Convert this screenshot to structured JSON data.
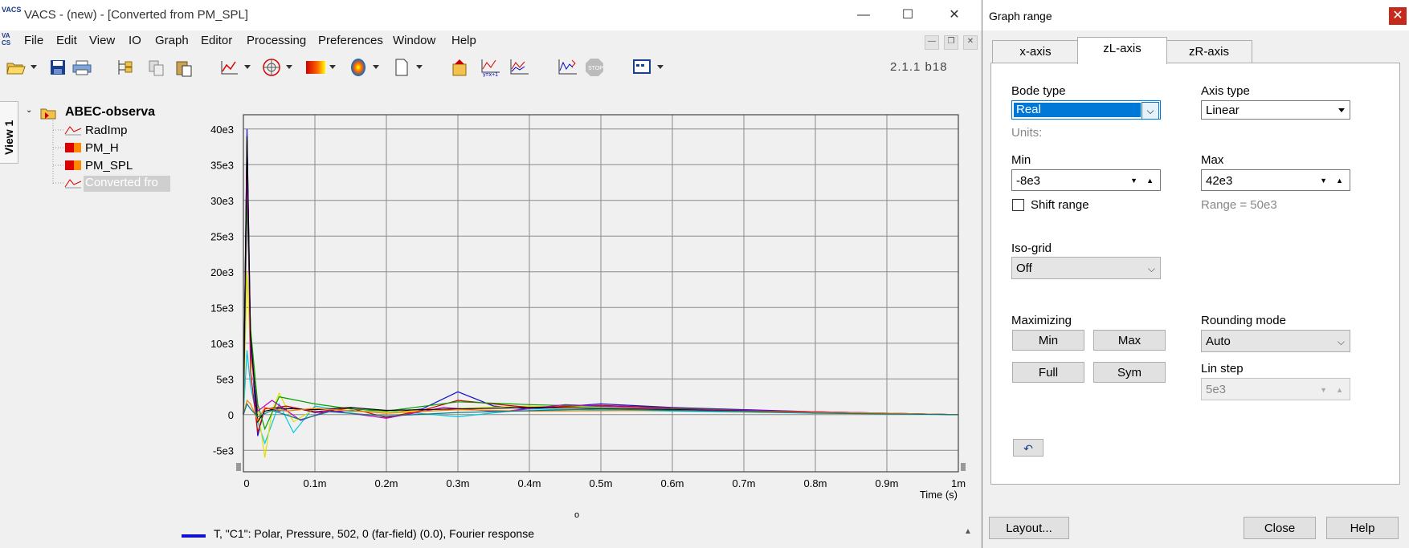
{
  "app": {
    "title": "VACS - (new) - [Converted from PM_SPL]",
    "logo_text": "VACS",
    "version": "2.1.1 b18",
    "window_controls": {
      "minimize": "—",
      "maximize": "☐",
      "close": "✕"
    }
  },
  "menu": [
    "File",
    "Edit",
    "View",
    "IO",
    "Graph",
    "Editor",
    "Processing",
    "Preferences",
    "Window",
    "Help"
  ],
  "view_tab": "View 1",
  "tree": {
    "root": "ABEC-observa",
    "children": [
      "RadImp",
      "PM_H",
      "PM_SPL",
      "Converted fro"
    ]
  },
  "chart_data": {
    "type": "line",
    "xlabel": "Time  (s)",
    "x_ticks": [
      "0",
      "0.1m",
      "0.2m",
      "0.3m",
      "0.4m",
      "0.5m",
      "0.6m",
      "0.7m",
      "0.8m",
      "0.9m",
      "1m"
    ],
    "y_ticks": [
      "40e3",
      "35e3",
      "30e3",
      "25e3",
      "20e3",
      "15e3",
      "10e3",
      "5e3",
      "0",
      "-5e3"
    ],
    "xlim": [
      0,
      0.001
    ],
    "ylim": [
      -8000,
      42000
    ],
    "grid": true,
    "series": [
      {
        "color": "#1010d0",
        "x": [
          0,
          5e-06,
          1e-05,
          2e-05,
          3e-05,
          5e-05,
          7e-05,
          0.0001,
          0.00015,
          0.0002,
          0.00025,
          0.0003,
          0.00035,
          0.0004,
          0.0005,
          0.0006,
          0.0008,
          0.001
        ],
        "y": [
          0,
          40000,
          10000,
          -3000,
          1000,
          500,
          1000,
          300,
          600,
          200,
          800,
          3200,
          1200,
          800,
          1500,
          1000,
          400,
          0
        ]
      },
      {
        "color": "#00c8e0",
        "x": [
          0,
          5e-06,
          1e-05,
          2e-05,
          3e-05,
          5e-05,
          7e-05,
          0.0001,
          0.00015,
          0.0002,
          0.0003,
          0.0004,
          0.0006,
          0.001
        ],
        "y": [
          0,
          9000,
          4000,
          -1000,
          -4000,
          1500,
          -2500,
          1200,
          400,
          600,
          -300,
          800,
          500,
          0
        ]
      },
      {
        "color": "#e0e000",
        "x": [
          0,
          5e-06,
          1e-05,
          2e-05,
          3e-05,
          4e-05,
          5e-05,
          7e-05,
          0.0001,
          0.0002,
          0.0003,
          0.0004,
          0.0006,
          0.001
        ],
        "y": [
          0,
          20000,
          8000,
          1000,
          -6000,
          500,
          3000,
          -1000,
          800,
          300,
          900,
          1200,
          700,
          0
        ]
      },
      {
        "color": "#d00000",
        "x": [
          0,
          5e-06,
          1e-05,
          2e-05,
          3e-05,
          6e-05,
          0.0001,
          0.00015,
          0.0002,
          0.00025,
          0.0003,
          0.0004,
          0.0005,
          0.0007,
          0.001
        ],
        "y": [
          0,
          38000,
          6000,
          -2500,
          800,
          1200,
          400,
          900,
          -400,
          600,
          2000,
          1000,
          1300,
          600,
          0
        ]
      },
      {
        "color": "#00a000",
        "x": [
          0,
          5e-06,
          1e-05,
          2e-05,
          3e-05,
          5e-05,
          0.0001,
          0.00015,
          0.0002,
          0.0003,
          0.0004,
          0.0006,
          0.0008,
          0.001
        ],
        "y": [
          0,
          30000,
          12000,
          1500,
          -2000,
          2500,
          1500,
          800,
          500,
          1800,
          1400,
          900,
          300,
          0
        ]
      },
      {
        "color": "#c000c0",
        "x": [
          0,
          5e-06,
          1e-05,
          2e-05,
          4e-05,
          8e-05,
          0.00012,
          0.0002,
          0.00028,
          0.00036,
          0.00045,
          0.0006,
          0.0008,
          0.001
        ],
        "y": [
          0,
          35000,
          9000,
          500,
          2000,
          -800,
          600,
          -500,
          1000,
          400,
          1400,
          800,
          400,
          0
        ]
      },
      {
        "color": "#000000",
        "x": [
          0,
          5e-06,
          1e-05,
          2e-05,
          3e-05,
          5e-05,
          0.0001,
          0.00015,
          0.0002,
          0.0003,
          0.0004,
          0.0005,
          0.0007,
          0.001
        ],
        "y": [
          0,
          39000,
          11000,
          -1000,
          500,
          900,
          700,
          1000,
          600,
          800,
          1000,
          900,
          500,
          0
        ]
      },
      {
        "color": "#ff8000",
        "x": [
          0,
          5e-06,
          1e-05,
          2e-05,
          3e-05,
          6e-05,
          0.0001,
          0.0002,
          0.0003,
          0.0004,
          0.0006,
          0.0009,
          0.001
        ],
        "y": [
          0,
          2000,
          1500,
          -800,
          1000,
          500,
          900,
          200,
          700,
          500,
          600,
          200,
          0
        ]
      },
      {
        "color": "#008080",
        "x": [
          0,
          5e-06,
          1e-05,
          2e-05,
          4e-05,
          8e-05,
          0.00012,
          0.0002,
          0.0003,
          0.0005,
          0.0008,
          0.001
        ],
        "y": [
          0,
          1500,
          800,
          -300,
          600,
          -700,
          400,
          -200,
          300,
          800,
          200,
          0
        ]
      }
    ]
  },
  "legend": {
    "color": "#1010d0",
    "text": "T, \"C1\": Polar, Pressure, 502, 0 (far-field) (0.0), Fourier response",
    "marker": "o"
  },
  "dialog": {
    "title": "Graph range",
    "close": "✕",
    "tabs": [
      "x-axis",
      "zL-axis",
      "zR-axis"
    ],
    "active_tab": "zL-axis",
    "bode_type_label": "Bode type",
    "bode_type_value": "Real",
    "axis_type_label": "Axis type",
    "axis_type_value": "Linear",
    "units_label": "Units:",
    "min_label": "Min",
    "min_value": "-8e3",
    "max_label": "Max",
    "max_value": "42e3",
    "shift_range_label": "Shift range",
    "range_text": "Range = 50e3",
    "iso_grid_label": "Iso-grid",
    "iso_grid_value": "Off",
    "maximizing_label": "Maximizing",
    "btn_min": "Min",
    "btn_max": "Max",
    "btn_full": "Full",
    "btn_sym": "Sym",
    "rounding_mode_label": "Rounding mode",
    "rounding_mode_value": "Auto",
    "lin_step_label": "Lin step",
    "lin_step_value": "5e3",
    "undo": "↶",
    "layout_button": "Layout...",
    "close_button": "Close",
    "help_button": "Help"
  }
}
